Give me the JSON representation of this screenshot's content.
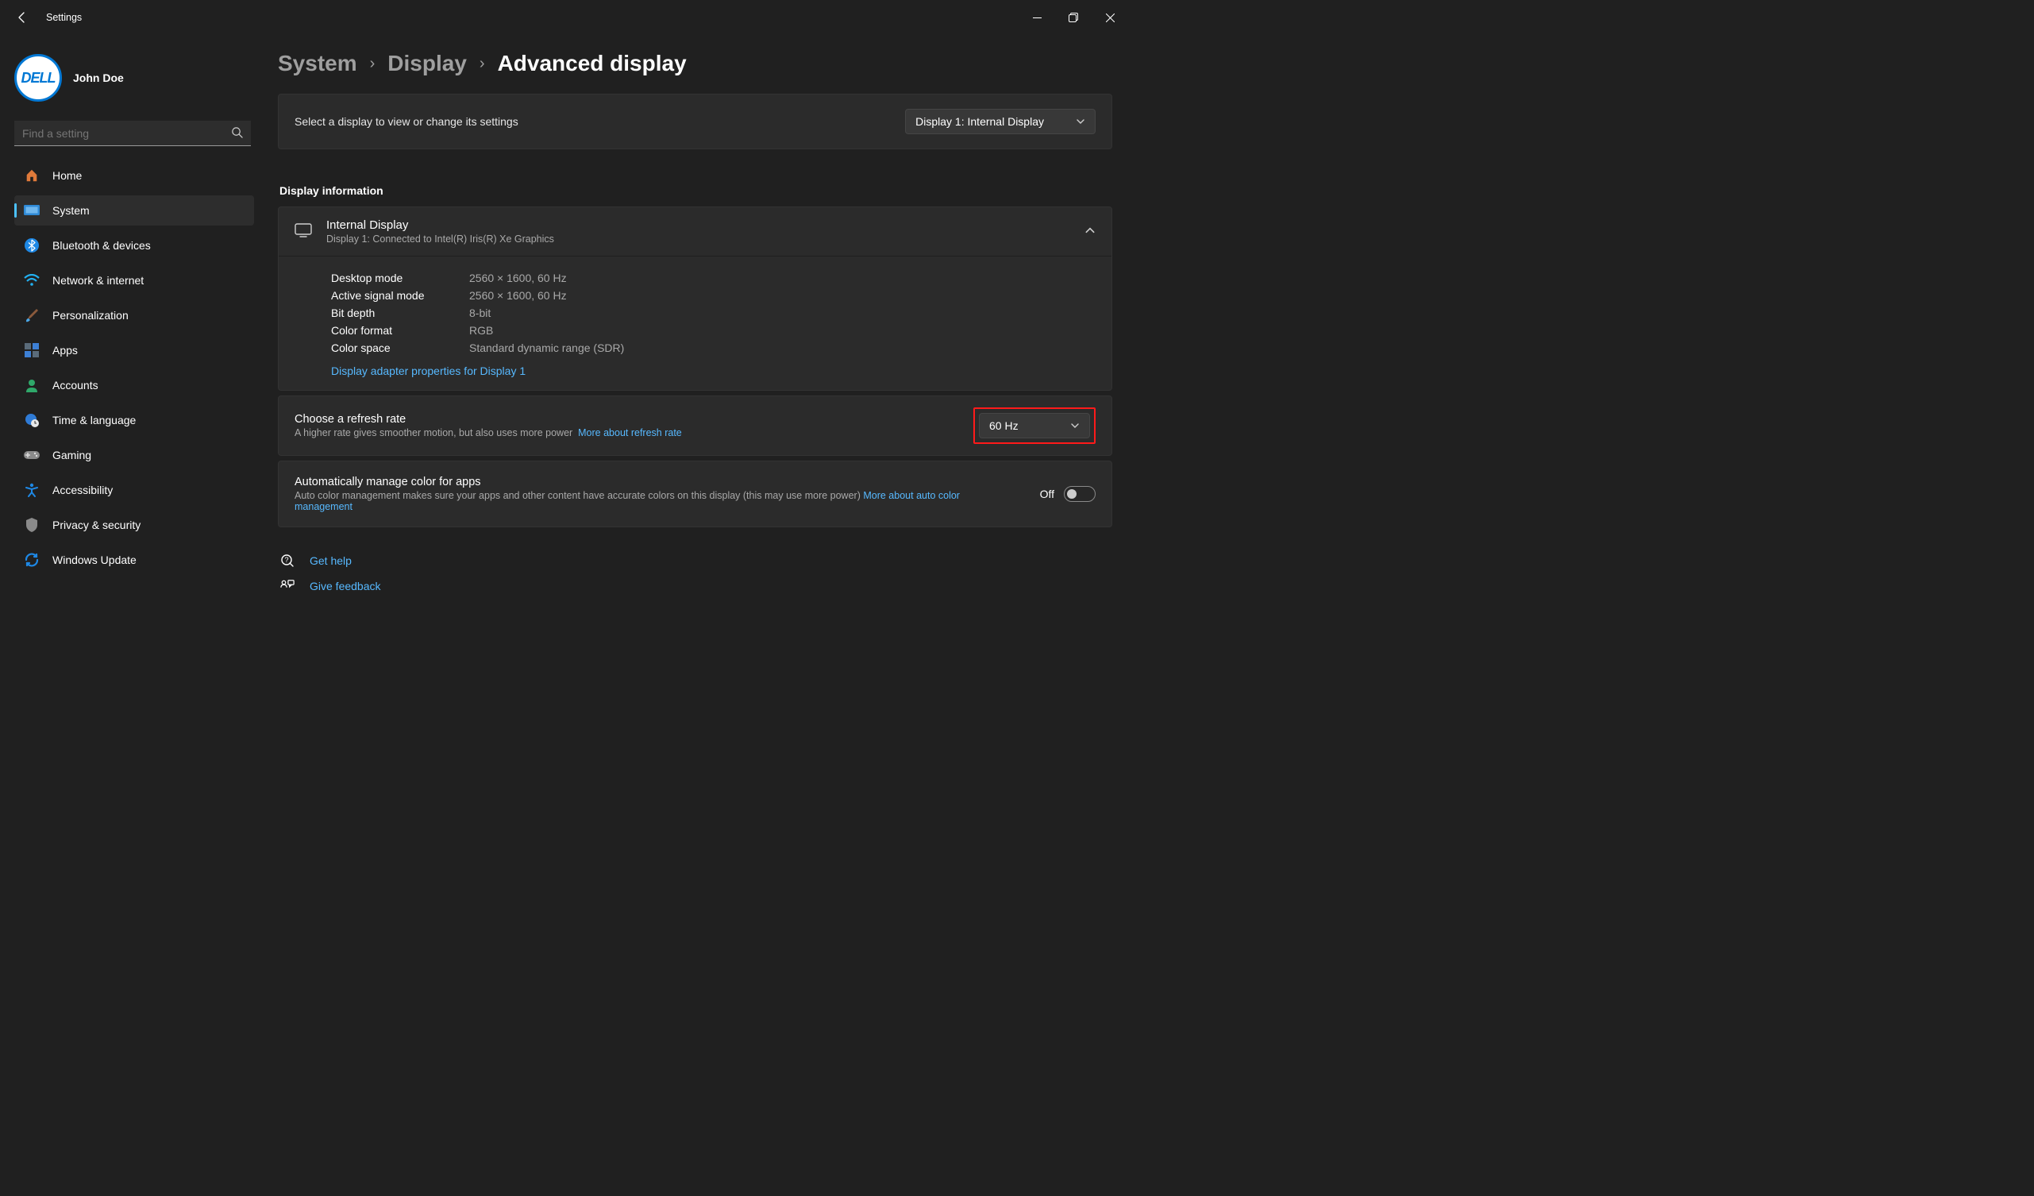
{
  "window": {
    "title": "Settings"
  },
  "profile": {
    "name": "John Doe",
    "avatar_text": "DELL"
  },
  "search": {
    "placeholder": "Find a setting"
  },
  "sidebar": {
    "items": [
      {
        "label": "Home"
      },
      {
        "label": "System"
      },
      {
        "label": "Bluetooth & devices"
      },
      {
        "label": "Network & internet"
      },
      {
        "label": "Personalization"
      },
      {
        "label": "Apps"
      },
      {
        "label": "Accounts"
      },
      {
        "label": "Time & language"
      },
      {
        "label": "Gaming"
      },
      {
        "label": "Accessibility"
      },
      {
        "label": "Privacy & security"
      },
      {
        "label": "Windows Update"
      }
    ],
    "selected_index": 1
  },
  "breadcrumb": [
    {
      "label": "System"
    },
    {
      "label": "Display"
    },
    {
      "label": "Advanced display"
    }
  ],
  "select_display": {
    "prompt": "Select a display to view or change its settings",
    "selected": "Display 1: Internal Display"
  },
  "display_info": {
    "section_title": "Display information",
    "name": "Internal Display",
    "connection": "Display 1: Connected to Intel(R) Iris(R) Xe Graphics",
    "rows": [
      {
        "k": "Desktop mode",
        "v": "2560 × 1600, 60 Hz"
      },
      {
        "k": "Active signal mode",
        "v": "2560 × 1600, 60 Hz"
      },
      {
        "k": "Bit depth",
        "v": "8-bit"
      },
      {
        "k": "Color format",
        "v": "RGB"
      },
      {
        "k": "Color space",
        "v": "Standard dynamic range (SDR)"
      }
    ],
    "adapter_link": "Display adapter properties for Display 1"
  },
  "refresh_rate": {
    "title": "Choose a refresh rate",
    "desc": "A higher rate gives smoother motion, but also uses more power",
    "more_link": "More about refresh rate",
    "selected": "60 Hz"
  },
  "auto_color": {
    "title": "Automatically manage color for apps",
    "desc": "Auto color management makes sure your apps and other content have accurate colors on this display (this may use more power)",
    "more_link": "More about auto color management",
    "state_label": "Off",
    "state": false
  },
  "help": {
    "get_help": "Get help",
    "feedback": "Give feedback"
  },
  "icons": {
    "home": "home-icon",
    "system": "system-icon",
    "bluetooth": "bluetooth-icon",
    "network": "wifi-icon",
    "personalization": "brush-icon",
    "apps": "apps-icon",
    "accounts": "person-icon",
    "time": "globe-clock-icon",
    "gaming": "gamepad-icon",
    "accessibility": "accessibility-icon",
    "privacy": "shield-icon",
    "update": "sync-icon"
  },
  "colors": {
    "accent": "#4cc2ff",
    "link": "#57b9ff",
    "highlight": "#ff1a1a",
    "bg": "#202020",
    "card": "#2b2b2b"
  }
}
